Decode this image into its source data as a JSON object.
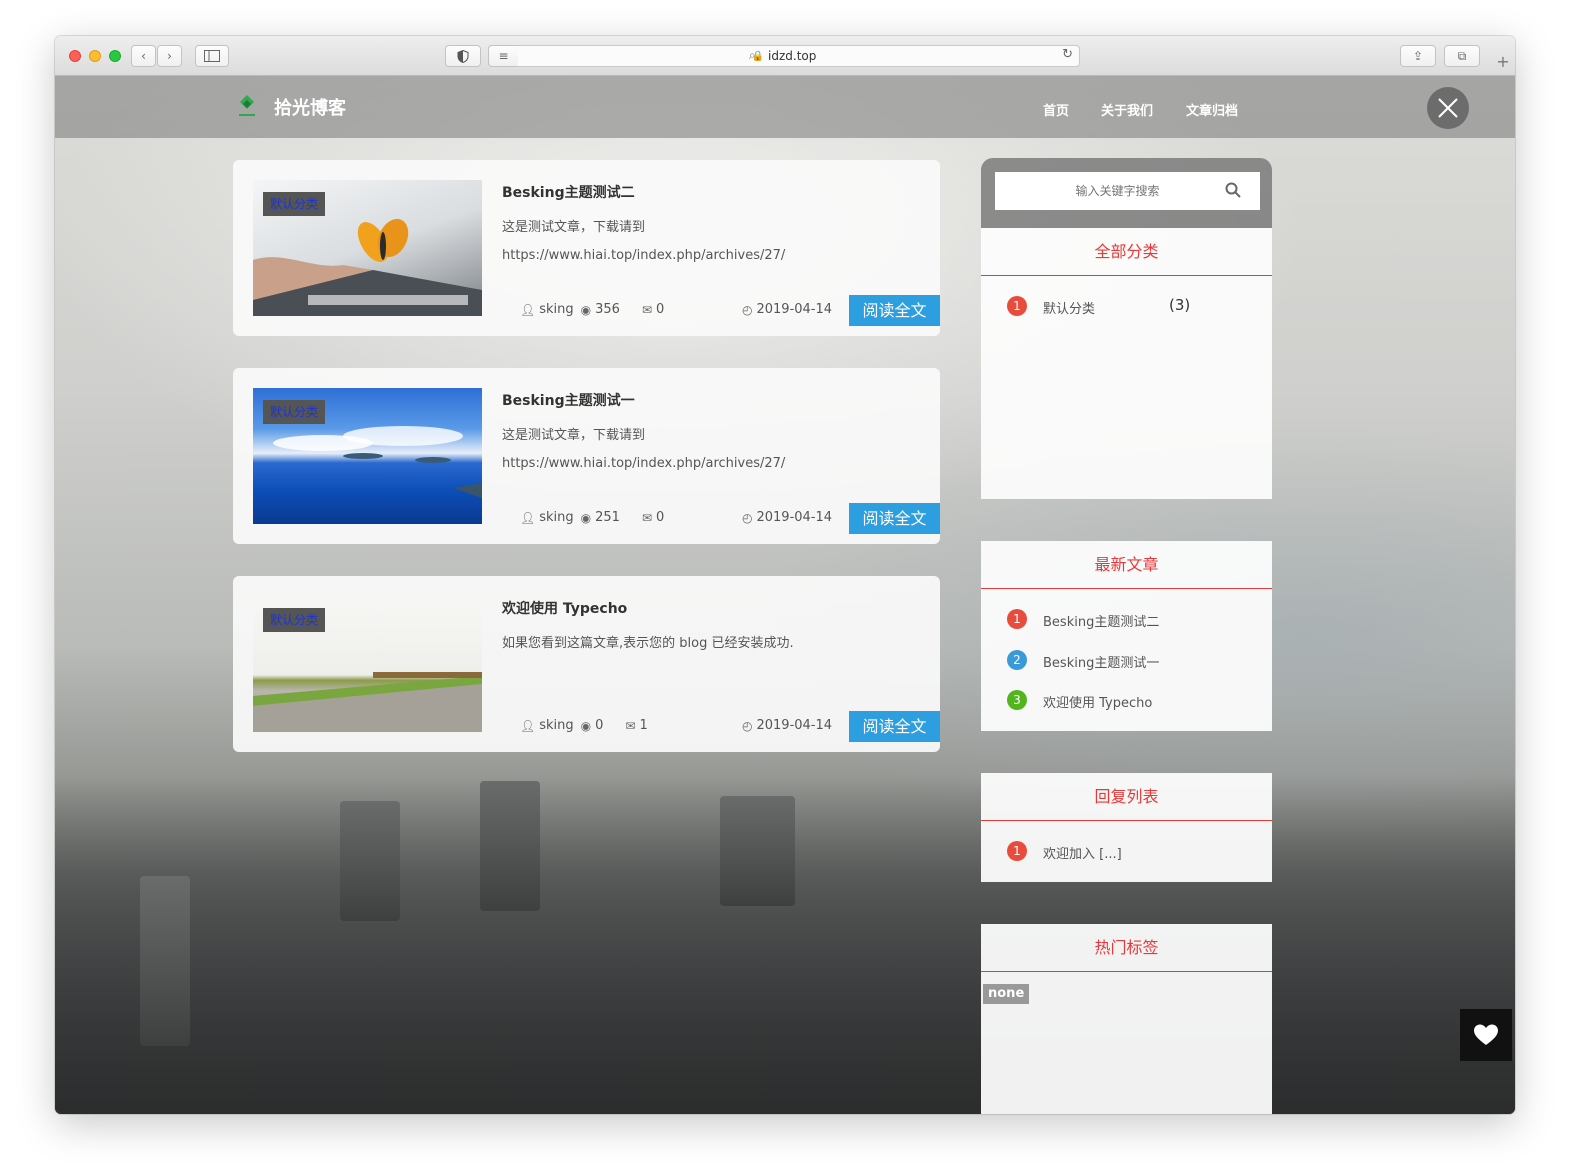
{
  "browser": {
    "url": "idzd.top"
  },
  "site": {
    "logo_text": "拾光博客",
    "nav": [
      "首页",
      "关于我们",
      "文章归档"
    ]
  },
  "posts": [
    {
      "badge": "默认分类",
      "title": "Besking主题测试二",
      "desc": "这是测试文章，下载请到",
      "link": "https://www.hiai.top/index.php/archives/27/",
      "author": "sking",
      "views": "356",
      "comments": "0",
      "date": "2019-04-14",
      "read_label": "阅读全文"
    },
    {
      "badge": "默认分类",
      "title": "Besking主题测试一",
      "desc": "这是测试文章，下载请到",
      "link": "https://www.hiai.top/index.php/archives/27/",
      "author": "sking",
      "views": "251",
      "comments": "0",
      "date": "2019-04-14",
      "read_label": "阅读全文"
    },
    {
      "badge": "默认分类",
      "title": "欢迎使用 Typecho",
      "desc": "如果您看到这篇文章,表示您的 blog 已经安装成功.",
      "link": "",
      "author": "sking",
      "views": "0",
      "comments": "1",
      "date": "2019-04-14",
      "read_label": "阅读全文"
    }
  ],
  "sidebar": {
    "search_placeholder": "输入关键字搜索",
    "categories": {
      "title": "全部分类",
      "items": [
        {
          "rank": "1",
          "name": "默认分类",
          "count": "(3)"
        }
      ]
    },
    "latest": {
      "title": "最新文章",
      "items": [
        {
          "rank": "1",
          "name": "Besking主题测试二"
        },
        {
          "rank": "2",
          "name": "Besking主题测试一"
        },
        {
          "rank": "3",
          "name": "欢迎使用 Typecho"
        }
      ]
    },
    "replies": {
      "title": "回复列表",
      "items": [
        {
          "rank": "1",
          "name": "欢迎加入 [...]"
        }
      ]
    },
    "tags": {
      "title": "热门标签",
      "items": [
        "none"
      ]
    }
  },
  "colors": {
    "accent_red": "#e8393a",
    "button_blue": "#2d9ee0"
  }
}
